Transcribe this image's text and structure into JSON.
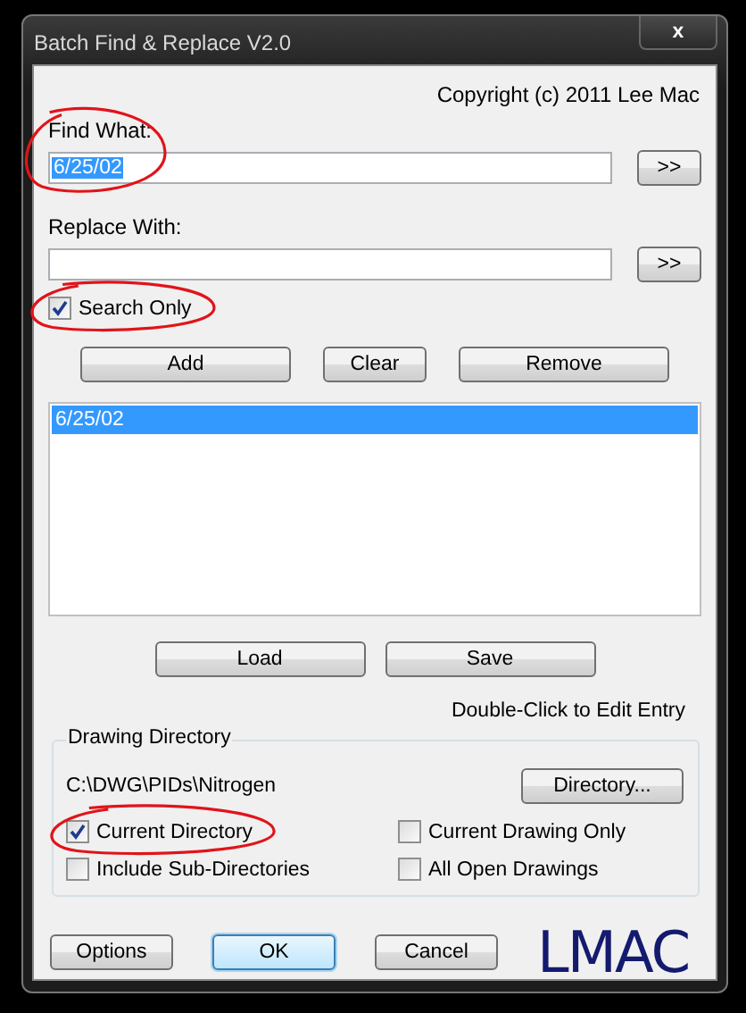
{
  "window": {
    "title": "Batch Find & Replace V2.0",
    "close": "x"
  },
  "copyright": "Copyright (c) 2011 Lee Mac",
  "find": {
    "label": "Find What:",
    "value": "6/25/02",
    "text_selected": true,
    "button": ">>",
    "circled": true
  },
  "replace": {
    "label": "Replace With:",
    "button": ">>"
  },
  "search_only": {
    "label": "Search Only",
    "checked": true,
    "circled": true
  },
  "list_buttons": [
    "Add",
    "Clear",
    "Remove"
  ],
  "entries": [
    {
      "text": "6/25/02",
      "selected": true
    }
  ],
  "file_buttons": [
    "Load",
    "Save"
  ],
  "hint": "Double-Click to Edit Entry",
  "directory": {
    "title": "Drawing Directory",
    "path": "C:\\DWG\\PIDs\\Nitrogen",
    "button": "Directory...",
    "options": [
      {
        "label": "Current Directory",
        "checked": true,
        "circled": true
      },
      {
        "label": "Current Drawing Only",
        "checked": false,
        "circled": false
      },
      {
        "label": "Include Sub-Directories",
        "checked": false,
        "circled": false
      },
      {
        "label": "All Open Drawings",
        "checked": false,
        "circled": false
      }
    ]
  },
  "buttons": [
    {
      "label": "Options",
      "default": false
    },
    {
      "label": "OK",
      "default": true
    },
    {
      "label": "Cancel",
      "default": false
    }
  ],
  "logo": "LMAC"
}
